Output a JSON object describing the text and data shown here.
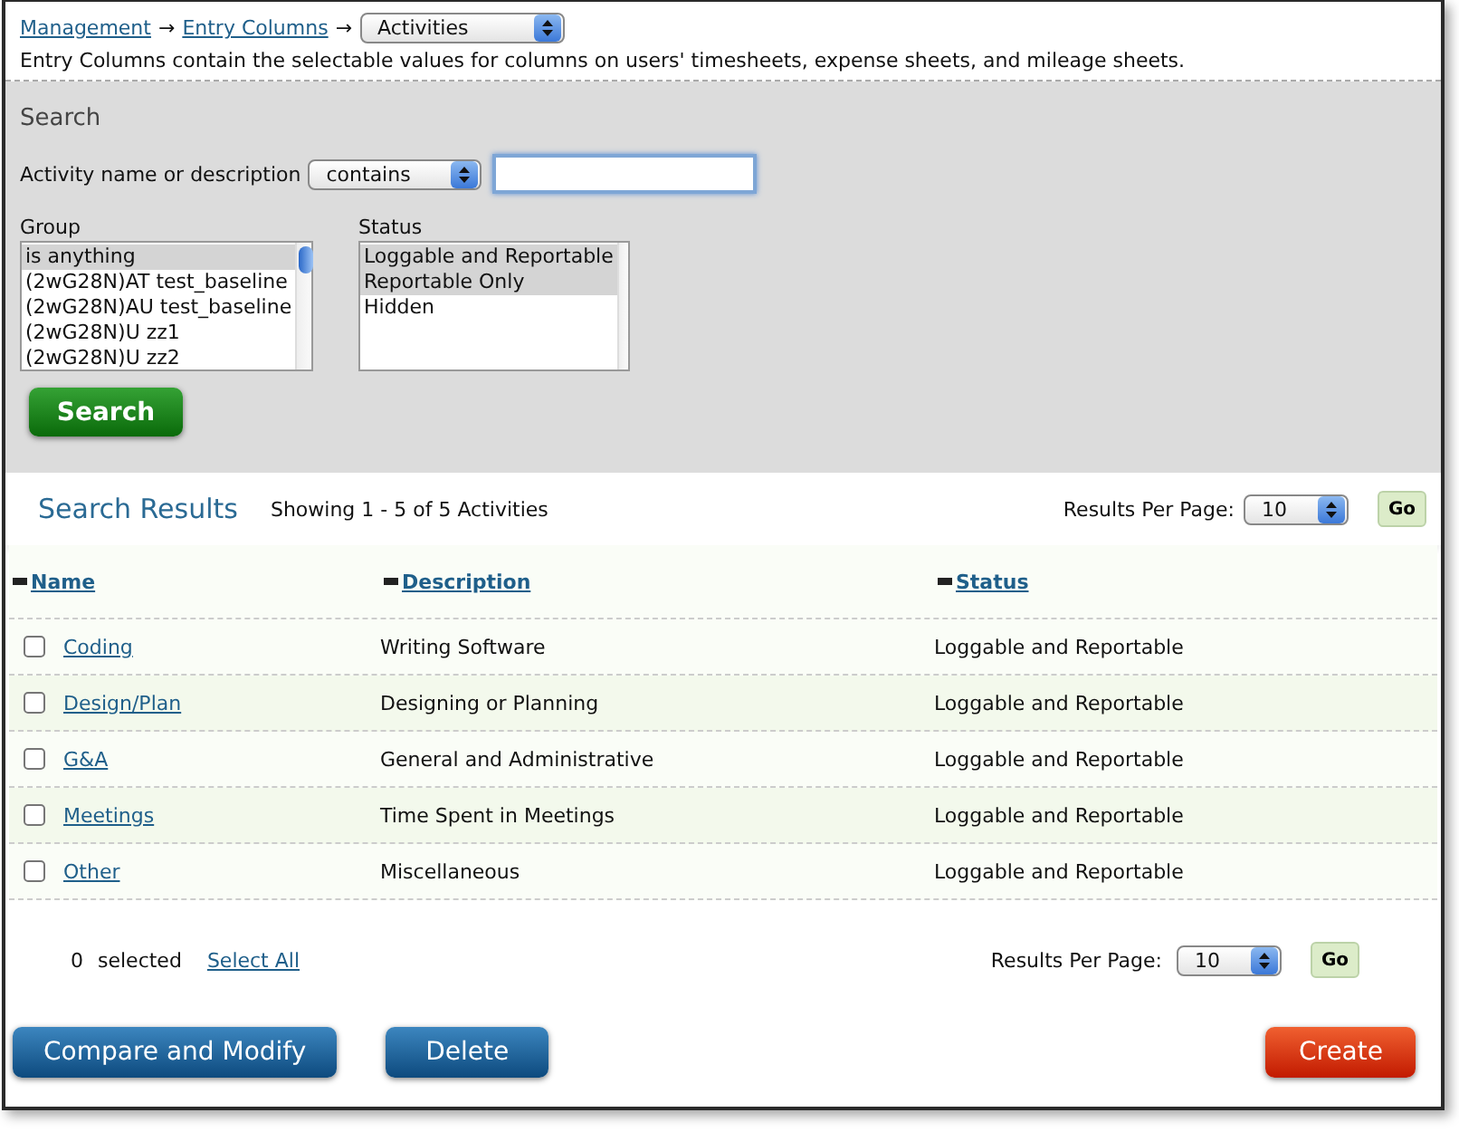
{
  "breadcrumb": {
    "links": [
      "Management",
      "Entry Columns"
    ],
    "separator": "→",
    "select": "Activities"
  },
  "description": "Entry Columns contain the selectable values for columns on users' timesheets, expense sheets, and mileage sheets.",
  "search": {
    "title": "Search",
    "field_label": "Activity name or description",
    "operator": "contains",
    "group": {
      "label": "Group",
      "items": [
        {
          "label": "is anything",
          "selected": true
        },
        {
          "label": "(2wG28N)AT test_baseline",
          "selected": false
        },
        {
          "label": "(2wG28N)AU test_baseline",
          "selected": false
        },
        {
          "label": "(2wG28N)U zz1",
          "selected": false
        },
        {
          "label": "(2wG28N)U zz2",
          "selected": false
        }
      ]
    },
    "status": {
      "label": "Status",
      "items": [
        {
          "label": "Loggable and Reportable",
          "selected": true
        },
        {
          "label": "Reportable Only",
          "selected": true
        },
        {
          "label": "Hidden",
          "selected": false
        }
      ]
    },
    "button": "Search"
  },
  "results": {
    "title": "Search Results",
    "summary": "Showing 1 - 5 of 5 Activities",
    "per_page_label": "Results Per Page:",
    "per_page": "10",
    "go": "Go"
  },
  "table": {
    "columns": [
      "Name",
      "Description",
      "Status"
    ],
    "rows": [
      {
        "name": "Coding",
        "description": "Writing Software",
        "status": "Loggable and Reportable",
        "checked": false
      },
      {
        "name": "Design/Plan",
        "description": "Designing or Planning",
        "status": "Loggable and Reportable",
        "checked": false
      },
      {
        "name": "G&A",
        "description": "General and Administrative",
        "status": "Loggable and Reportable",
        "checked": false
      },
      {
        "name": "Meetings",
        "description": "Time Spent in Meetings",
        "status": "Loggable and Reportable",
        "checked": false
      },
      {
        "name": "Other",
        "description": "Miscellaneous",
        "status": "Loggable and Reportable",
        "checked": false
      }
    ]
  },
  "footer": {
    "selected_count": "0",
    "selected_label": "selected",
    "select_all": "Select All",
    "per_page_label": "Results Per Page:",
    "per_page": "10",
    "go": "Go"
  },
  "actions": [
    {
      "label": "Compare and Modify",
      "kind": "primary"
    },
    {
      "label": "Delete",
      "kind": "primary"
    },
    {
      "label": "Create",
      "kind": "danger"
    }
  ]
}
